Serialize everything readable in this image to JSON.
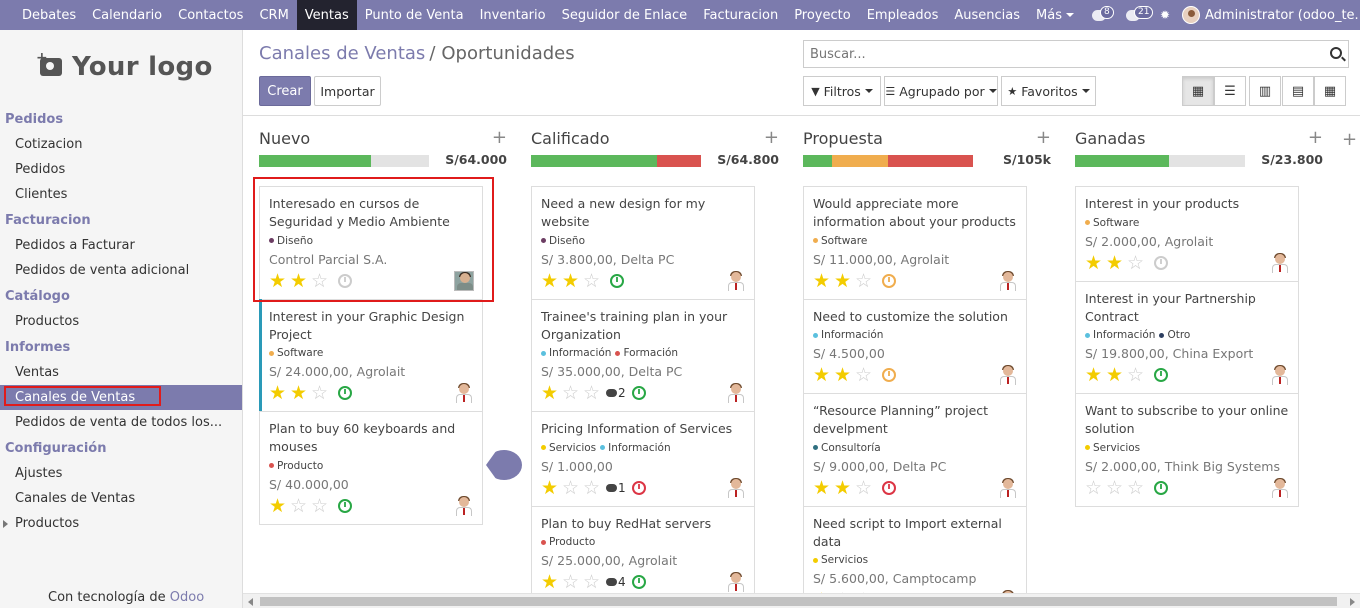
{
  "topnav": {
    "items": [
      "Debates",
      "Calendario",
      "Contactos",
      "CRM",
      "Ventas",
      "Punto de Venta",
      "Inventario",
      "Seguidor de Enlace",
      "Facturacion",
      "Proyecto",
      "Empleados",
      "Ausencias",
      "Más"
    ],
    "active_index": 4,
    "messages_count": "8",
    "activities_count": "21",
    "user": "Administrator (odoo_te..."
  },
  "sidebar": {
    "logo_text": "Your logo",
    "sections": [
      {
        "title": "Pedidos",
        "items": [
          "Cotizacion",
          "Pedidos",
          "Clientes"
        ]
      },
      {
        "title": "Facturacion",
        "items": [
          "Pedidos a Facturar",
          "Pedidos de venta adicional"
        ]
      },
      {
        "title": "Catálogo",
        "items": [
          "Productos"
        ]
      },
      {
        "title": "Informes",
        "items": [
          "Ventas",
          "Canales de Ventas",
          "Pedidos de venta de todos los..."
        ]
      },
      {
        "title": "Configuración",
        "items": [
          "Ajustes",
          "Canales de Ventas",
          "Productos"
        ]
      }
    ],
    "active_item": "Canales de Ventas",
    "powered_prefix": "Con tecnología de ",
    "powered_brand": "Odoo"
  },
  "control": {
    "breadcrumb_parent": "Canales de Ventas",
    "breadcrumb_sep": "/",
    "breadcrumb_current": "Oportunidades",
    "create_label": "Crear",
    "import_label": "Importar",
    "search_placeholder": "Buscar...",
    "filters_label": "Filtros",
    "groupby_label": "Agrupado por",
    "favorites_label": "Favoritos",
    "views": [
      "kanban",
      "list",
      "graph",
      "calendar",
      "pivot"
    ],
    "active_view": "kanban"
  },
  "colors": {
    "primary": "#7c7bad",
    "green": "#5cb85c",
    "red": "#d9534f",
    "orange": "#f0ad4e",
    "star": "#f3cc00",
    "highlight": "#e01b1b"
  },
  "columns": [
    {
      "title": "Nuevo",
      "total": "S/64.000",
      "progress": [
        {
          "color": "#5cb85c",
          "pct": 66
        }
      ],
      "cards": [
        {
          "name": "Interesado en cursos de Seguridad y Medio Ambiente",
          "tags": [
            {
              "label": "Diseño",
              "color": "#6c3d63"
            }
          ],
          "amount": "Control Parcial S.A.",
          "stars": 2,
          "activity": "grey",
          "avatar": "photo",
          "messages": ""
        },
        {
          "name": "Interest in your Graphic Design Project",
          "tags": [
            {
              "label": "Software",
              "color": "#f0ad4e"
            }
          ],
          "amount": "S/ 24.000,00, Agrolait",
          "stars": 2,
          "activity": "green",
          "avatar": "man",
          "messages": "",
          "selected": true
        },
        {
          "name": "Plan to buy 60 keyboards and mouses",
          "tags": [
            {
              "label": "Producto",
              "color": "#d9534f"
            }
          ],
          "amount": "S/ 40.000,00",
          "stars": 1,
          "activity": "green",
          "avatar": "man",
          "messages": ""
        }
      ]
    },
    {
      "title": "Calificado",
      "total": "S/64.800",
      "progress": [
        {
          "color": "#5cb85c",
          "pct": 74
        },
        {
          "color": "#d9534f",
          "pct": 26
        }
      ],
      "cards": [
        {
          "name": "Need a new design for my website",
          "tags": [
            {
              "label": "Diseño",
              "color": "#6c3d63"
            }
          ],
          "amount": "S/ 3.800,00, Delta PC",
          "stars": 2,
          "activity": "green",
          "avatar": "man",
          "messages": ""
        },
        {
          "name": "Trainee's training plan in your Organization",
          "tags": [
            {
              "label": "Información",
              "color": "#5bc0de"
            },
            {
              "label": "Formación",
              "color": "#d9534f"
            }
          ],
          "amount": "S/ 35.000,00, Delta PC",
          "stars": 1,
          "activity": "green",
          "avatar": "man",
          "messages": "2"
        },
        {
          "name": "Pricing Information of Services",
          "tags": [
            {
              "label": "Servicios",
              "color": "#f3cc00"
            },
            {
              "label": "Información",
              "color": "#5bc0de"
            }
          ],
          "amount": "S/ 1.000,00",
          "stars": 1,
          "activity": "red",
          "avatar": "man",
          "messages": "1"
        },
        {
          "name": "Plan to buy RedHat servers",
          "tags": [
            {
              "label": "Producto",
              "color": "#d9534f"
            }
          ],
          "amount": "S/ 25.000,00, Agrolait",
          "stars": 1,
          "activity": "green",
          "avatar": "man",
          "messages": "4"
        }
      ]
    },
    {
      "title": "Propuesta",
      "total": "S/105k",
      "progress": [
        {
          "color": "#5cb85c",
          "pct": 17
        },
        {
          "color": "#f0ad4e",
          "pct": 33
        },
        {
          "color": "#d9534f",
          "pct": 50
        }
      ],
      "cards": [
        {
          "name": "Would appreciate more information about your products",
          "tags": [
            {
              "label": "Software",
              "color": "#f0ad4e"
            }
          ],
          "amount": "S/ 11.000,00, Agrolait",
          "stars": 2,
          "activity": "orange",
          "avatar": "man",
          "messages": ""
        },
        {
          "name": "Need to customize the solution",
          "tags": [
            {
              "label": "Información",
              "color": "#5bc0de"
            }
          ],
          "amount": "S/ 4.500,00",
          "stars": 2,
          "activity": "orange",
          "avatar": "man",
          "messages": ""
        },
        {
          "name": "“Resource Planning” project develpment",
          "tags": [
            {
              "label": "Consultoría",
              "color": "#2f6f80"
            }
          ],
          "amount": "S/ 9.000,00, Delta PC",
          "stars": 2,
          "activity": "red",
          "avatar": "man",
          "messages": ""
        },
        {
          "name": "Need script to Import external data",
          "tags": [
            {
              "label": "Servicios",
              "color": "#f3cc00"
            }
          ],
          "amount": "S/ 5.600,00, Camptocamp",
          "stars": 1,
          "activity": "red",
          "avatar": "man",
          "messages": ""
        }
      ]
    },
    {
      "title": "Ganadas",
      "total": "S/23.800",
      "progress": [
        {
          "color": "#5cb85c",
          "pct": 55
        }
      ],
      "cards": [
        {
          "name": "Interest in your products",
          "tags": [
            {
              "label": "Software",
              "color": "#f0ad4e"
            }
          ],
          "amount": "S/ 2.000,00, Agrolait",
          "stars": 2,
          "activity": "grey",
          "avatar": "man",
          "messages": ""
        },
        {
          "name": "Interest in your Partnership Contract",
          "tags": [
            {
              "label": "Información",
              "color": "#5bc0de"
            },
            {
              "label": "Otro",
              "color": "#2d3e60"
            }
          ],
          "amount": "S/ 19.800,00, China Export",
          "stars": 2,
          "activity": "green",
          "avatar": "man",
          "messages": ""
        },
        {
          "name": "Want to subscribe to your online solution",
          "tags": [
            {
              "label": "Servicios",
              "color": "#f3cc00"
            }
          ],
          "amount": "S/ 2.000,00, Think Big Systems",
          "stars": 0,
          "activity": "green",
          "avatar": "man",
          "messages": ""
        }
      ]
    }
  ]
}
